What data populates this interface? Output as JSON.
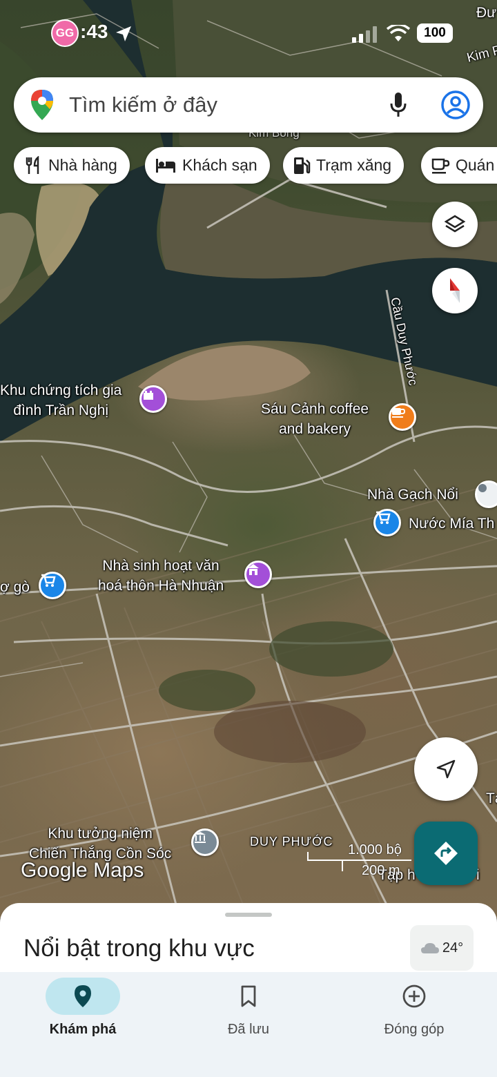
{
  "status_bar": {
    "time": ":43",
    "avatar_text": "GG",
    "battery": "100",
    "icons": [
      "location-arrow-icon",
      "signal-icon",
      "wifi-icon",
      "battery-icon"
    ]
  },
  "search": {
    "placeholder": "Tìm kiếm ở đây",
    "icons": [
      "google-maps-logo",
      "microphone-icon",
      "account-icon"
    ]
  },
  "chips": [
    {
      "label": "Nhà hàng",
      "icon": "restaurant-icon"
    },
    {
      "label": "Khách sạn",
      "icon": "hotel-bed-icon"
    },
    {
      "label": "Trạm xăng",
      "icon": "gas-station-icon"
    },
    {
      "label": "Quán",
      "icon": "coffee-cup-icon"
    }
  ],
  "map": {
    "labels": {
      "top_right_1": "Đư",
      "top_right_2": "Kim P",
      "top_road": "Kim Bồng",
      "bridge": "Cầu Duy Phước",
      "poi_tran_nghi": "Khu chứng tích gia\nđình Trần Nghị",
      "poi_sau_canh": "Sáu Cảnh coffee\nand bakery",
      "poi_nha_gach": "Nhà Gạch Nổi",
      "poi_nuoc_mia": "Nước Mía Th",
      "poi_nha_sinh_hoat": "Nhà sinh hoạt văn\nhoá thôn Hà Nhuận",
      "poi_cho_go": "ợ gò",
      "poi_khu_tuong_niem": "Khu tưởng niệm\nChiến Thắng Cồn Sóc",
      "area_duy_phuoc": "DUY PHƯỚC",
      "poi_tap_hoa": "Tạp h",
      "poi_tap_hoa_suffix": "i",
      "poi_right_edge": "Tạ",
      "branding": "Google Maps",
      "scale_top": "1.000 bộ",
      "scale_bottom": "200 m"
    }
  },
  "sheet": {
    "title": "Nổi bật trong khu vực",
    "weather": "24°"
  },
  "nav": [
    {
      "label": "Khám phá",
      "icon": "explore-pin-icon",
      "active": true
    },
    {
      "label": "Đã lưu",
      "icon": "bookmark-icon",
      "active": false
    },
    {
      "label": "Đóng góp",
      "icon": "add-circle-icon",
      "active": false
    }
  ],
  "colors": {
    "accent": "#0b6b73",
    "nav_active_pill": "#bfe6ef",
    "poi_purple": "#a34fd8",
    "poi_blue": "#1a86e8",
    "poi_orange": "#f07d1b"
  }
}
